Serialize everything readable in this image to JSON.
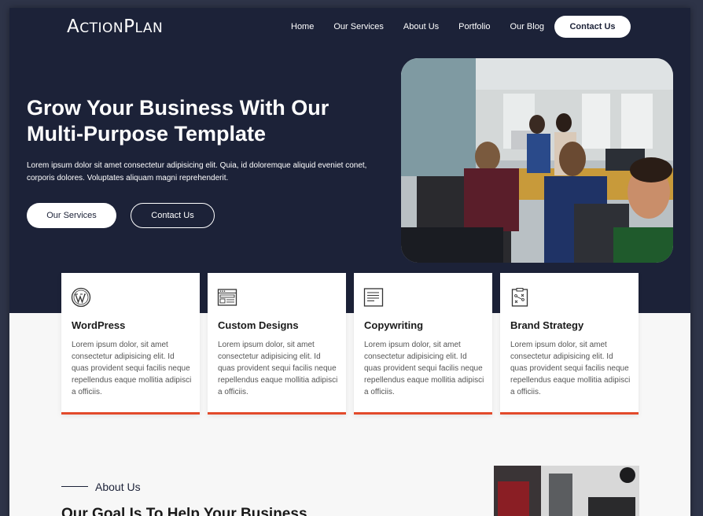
{
  "brand": {
    "logo_a": "A",
    "logo_b": "CTION",
    "logo_c": "P",
    "logo_d": "LAN"
  },
  "nav": {
    "items": [
      "Home",
      "Our Services",
      "About Us",
      "Portfolio",
      "Our Blog"
    ],
    "contact_label": "Contact Us"
  },
  "hero": {
    "headline_line1": "Grow Your Business With Our",
    "headline_line2": "Multi-Purpose Template",
    "subtext": "Lorem ipsum dolor sit amet consectetur adipisicing elit. Quia, id doloremque aliquid eveniet conet, corporis dolores. Voluptates aliquam magni reprehenderit.",
    "primary_button": "Our Services",
    "secondary_button": "Contact Us"
  },
  "cards": [
    {
      "icon": "wordpress-icon",
      "title": "WordPress",
      "body": "Lorem ipsum dolor, sit amet consectetur adipisicing elit. Id quas provident sequi facilis neque repellendus eaque mollitia adipisci a officiis."
    },
    {
      "icon": "browser-window-icon",
      "title": "Custom Designs",
      "body": "Lorem ipsum dolor, sit amet consectetur adipisicing elit. Id quas provident sequi facilis neque repellendus eaque mollitia adipisci a officiis."
    },
    {
      "icon": "document-icon",
      "title": "Copywriting",
      "body": "Lorem ipsum dolor, sit amet consectetur adipisicing elit. Id quas provident sequi facilis neque repellendus eaque mollitia adipisci a officiis."
    },
    {
      "icon": "strategy-clipboard-icon",
      "title": "Brand Strategy",
      "body": "Lorem ipsum dolor, sit amet consectetur adipisicing elit. Id quas provident sequi facilis neque repellendus eaque mollitia adipisci a officiis."
    }
  ],
  "about": {
    "label": "About Us",
    "heading": "Our Goal Is To Help Your Business"
  },
  "colors": {
    "navy": "#1c2238",
    "accent": "#e24a2b",
    "page_bg": "#f7f7f7"
  }
}
